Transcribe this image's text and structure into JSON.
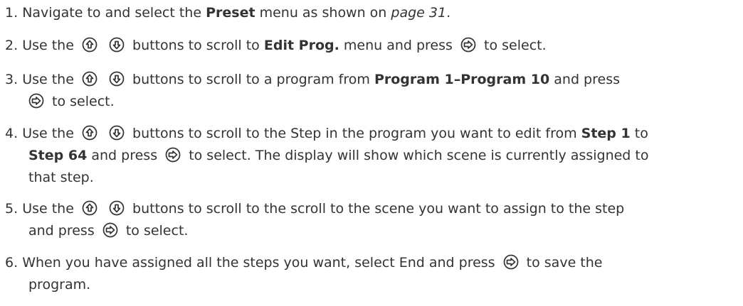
{
  "steps": [
    {
      "num": "1.",
      "a": "Navigate to and select the",
      "b": "Preset",
      "c": "menu as shown on",
      "d": "page 31",
      "e": "."
    },
    {
      "num": "2.",
      "a": "Use the",
      "b": "buttons to scroll to",
      "c": "Edit Prog.",
      "d": "menu and press",
      "e": "to select.",
      "icons": [
        "up-button-icon",
        "down-button-icon",
        "enter-button-icon"
      ]
    },
    {
      "num": "3.",
      "a": "Use the",
      "b": "buttons to scroll to a program from",
      "c": "Program 1–Program 10",
      "d": "and press",
      "e": "to select."
    },
    {
      "num": "4.",
      "a": "Use the",
      "b": "buttons to scroll to the Step in the program you want to edit from",
      "c": "Step 1",
      "d": "to",
      "e": "Step 64",
      "f": "and press",
      "g": "to select. The display will show which scene is currently assigned to",
      "h": "that step."
    },
    {
      "num": "5.",
      "a": "Use the",
      "b": "buttons to scroll to the scroll to the scene you want to assign to the step",
      "c": "and press",
      "d": "to select."
    },
    {
      "num": "6.",
      "a": "When you have assigned all the steps you want, select End and press",
      "b": "to save the",
      "c": "program."
    }
  ]
}
